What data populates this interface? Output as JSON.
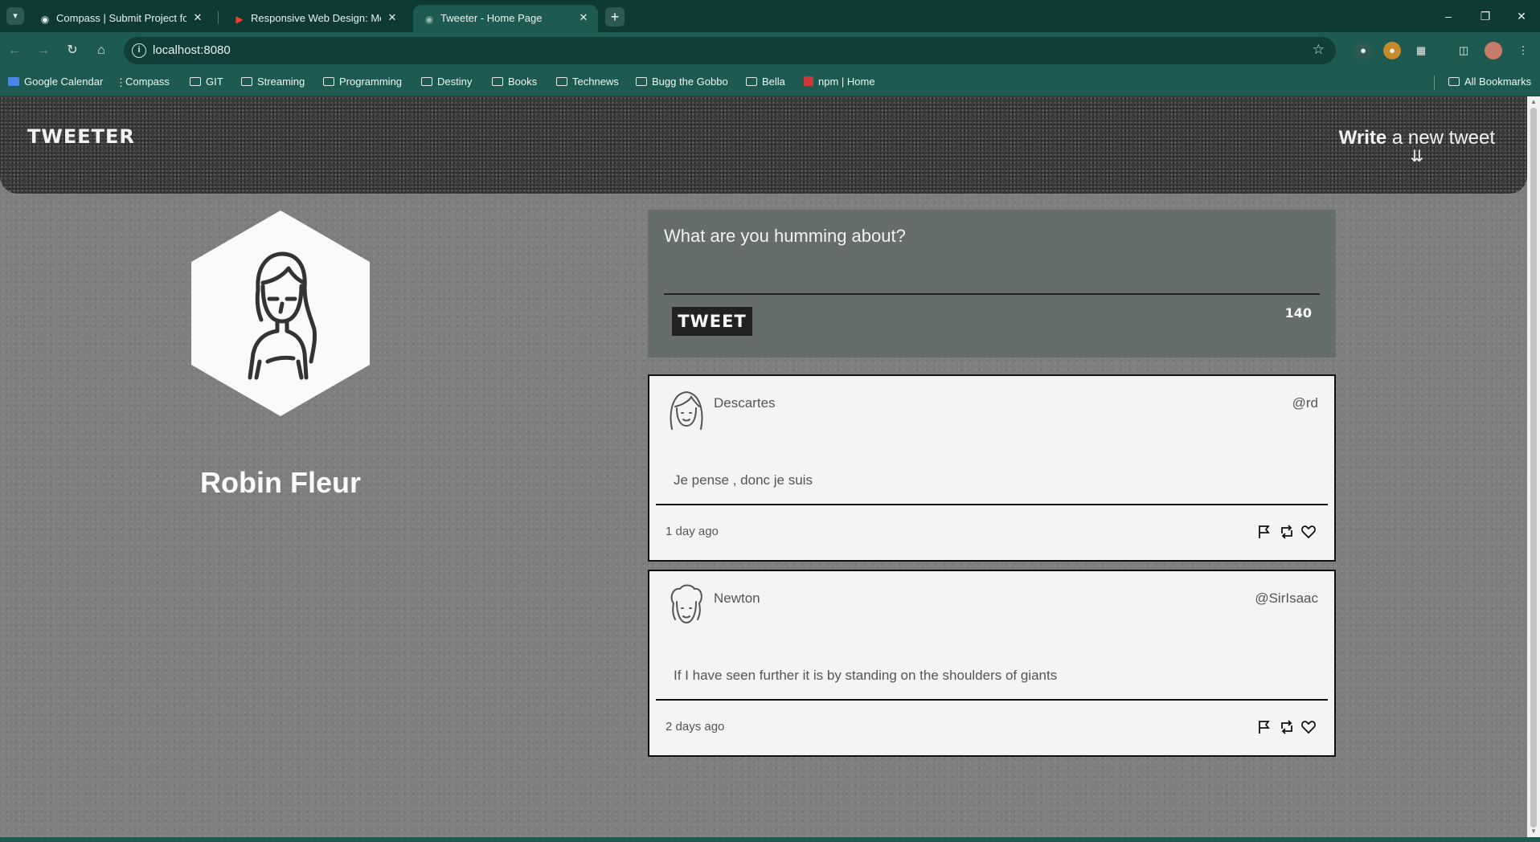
{
  "browser": {
    "tabs": [
      {
        "title": "Compass | Submit Project for E",
        "favicon": "compass-icon"
      },
      {
        "title": "Responsive Web Design: Medi",
        "favicon": "youtube-icon"
      },
      {
        "title": "Tweeter - Home Page",
        "favicon": "globe-icon",
        "active": true
      }
    ],
    "url": "localhost:8080",
    "bookmarks": [
      "Google Calendar",
      "Compass",
      "GIT",
      "Streaming",
      "Programming",
      "Destiny",
      "Books",
      "Technews",
      "Bugg the Gobbo",
      "Bella",
      "npm | Home"
    ],
    "all_bookmarks": "All Bookmarks",
    "accent": "#1f5a52"
  },
  "header": {
    "brand": "TWEETER",
    "compose_bold": "Write",
    "compose_rest": " a new tweet"
  },
  "profile": {
    "name": "Robin Fleur"
  },
  "composer": {
    "placeholder": "What are you humming about?",
    "button": "TWEET",
    "counter": "140"
  },
  "tweets": [
    {
      "name": "Descartes",
      "handle": "@rd",
      "content": "Je pense , donc je suis",
      "age": "1 day ago",
      "avatar": "woman-avatar-icon"
    },
    {
      "name": "Newton",
      "handle": "@SirIsaac",
      "content": "If I have seen further it is by standing on the shoulders of giants",
      "age": "2 days ago",
      "avatar": "man-avatar-icon"
    }
  ]
}
